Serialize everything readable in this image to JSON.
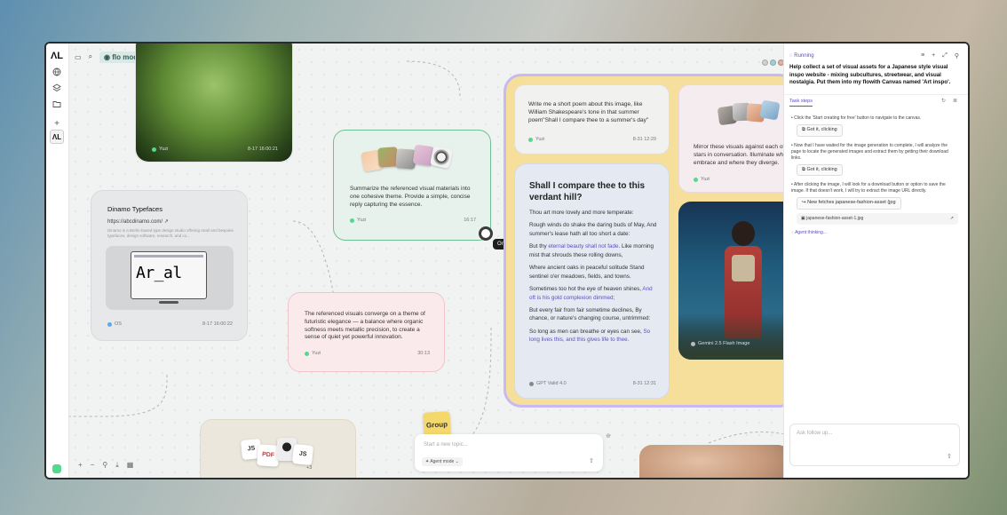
{
  "rail": {
    "icons": [
      "logo-icon",
      "globe-icon",
      "layers-icon",
      "folder-icon",
      "plus-icon",
      "app-icon"
    ]
  },
  "topbar": {
    "mode_label": "flo mode"
  },
  "cards": {
    "grass": {
      "author": "Yuzi",
      "time": "8-17 16:00:21"
    },
    "summarize": {
      "text": "Summarize the referenced visual materials into one cohesive theme. Provide a simple, concise reply capturing the essence.",
      "author": "Yuzi",
      "time": "16:17"
    },
    "dinamo": {
      "title": "Dinamo Typefaces",
      "url": "https://abcdinamo.com/ ↗",
      "desc": "Dinamo is a Berlin-based type design studio offering retail and bespoke typefaces, design software, research, and co...",
      "image_text": "Ar_al",
      "author": "OS",
      "time": "8-17 16:00:22"
    },
    "futuristic": {
      "text": "The referenced visuals converge on a theme of futuristic elegance — a balance where organic softness meets metallic precision, to create a sense of quiet yet powerful innovation.",
      "author": "Yuzi",
      "time": "30:13"
    },
    "poem_request": {
      "text": "Write me a short poem about this image, like William Shakespeare's tone in that summer poem\"Shall I compare thee to a summer's day\"",
      "author": "Yuzi",
      "time": "8-31 12:29"
    },
    "mirror": {
      "text": "Mirror these visuals against each other stars in conversation. Illuminate where embrace and where they diverge.",
      "author": "Yuzi"
    },
    "poem": {
      "title": "Shall I compare thee to this verdant hill?",
      "l1": "Thou art more lovely and more temperate:",
      "l2": "Rough winds do shake the daring buds of May, And summer's lease hath all too short a date:",
      "l3a": "But thy ",
      "l3b": "eternal beauty shall not fade",
      "l3c": ". Like morning mist that shrouds these rolling downs,",
      "l4": "Where ancient oaks in peaceful solitude Stand sentinel o'er meadows, fields, and towns.",
      "l5a": "Sometimes too hot the eye of heaven shines, ",
      "l5b": "And oft is his gold complexion dimmed;",
      "l6": "But every fair from fair sometime declines, By chance, or nature's changing course, untrimmed:",
      "l7a": "So long as men can breathe or eyes can see, ",
      "l7b": "So long lives this, and this gives life to thee.",
      "author": "GPT Valid 4.0",
      "time": "8-31 12:31"
    },
    "gemini": {
      "label": "Gemini 2.5 Flash Image"
    },
    "files": {
      "badges": [
        "JS",
        "PDF",
        "JS"
      ],
      "more": "+3"
    }
  },
  "tooltip": "On it, right now!",
  "group_label": "Group",
  "composer": {
    "placeholder": "Start a new topic...",
    "mode": "Agent mode"
  },
  "panel": {
    "status": "Running",
    "prompt": "Help collect a set of visual assets for a Japanese style visual inspo website - mixing subcultures, streetwear, and visual nostalgia. Put them into my flowith Canvas named 'Art inspo'.",
    "tab": "Task steps",
    "step1": "Click the 'Start creating for free' button to navigate to the canvas.",
    "step1_action": "Got it, clicking",
    "step2": "Now that I have waited for the image generation to complete, I will analyze the page to locate the generated images and extract them by getting their download links.",
    "step2_action": "Got it, clicking",
    "step3": "After clicking the image, I will look for a download button or option to save the image. If that doesn't work, I will try to extract the image URL directly.",
    "step3_action": "New fetches japanese-fashion-asset (jpg",
    "file": "japanese-fashion-asset-1.jpg",
    "thinking": "Agent thinking...",
    "followup_placeholder": "Ask follow up..."
  }
}
